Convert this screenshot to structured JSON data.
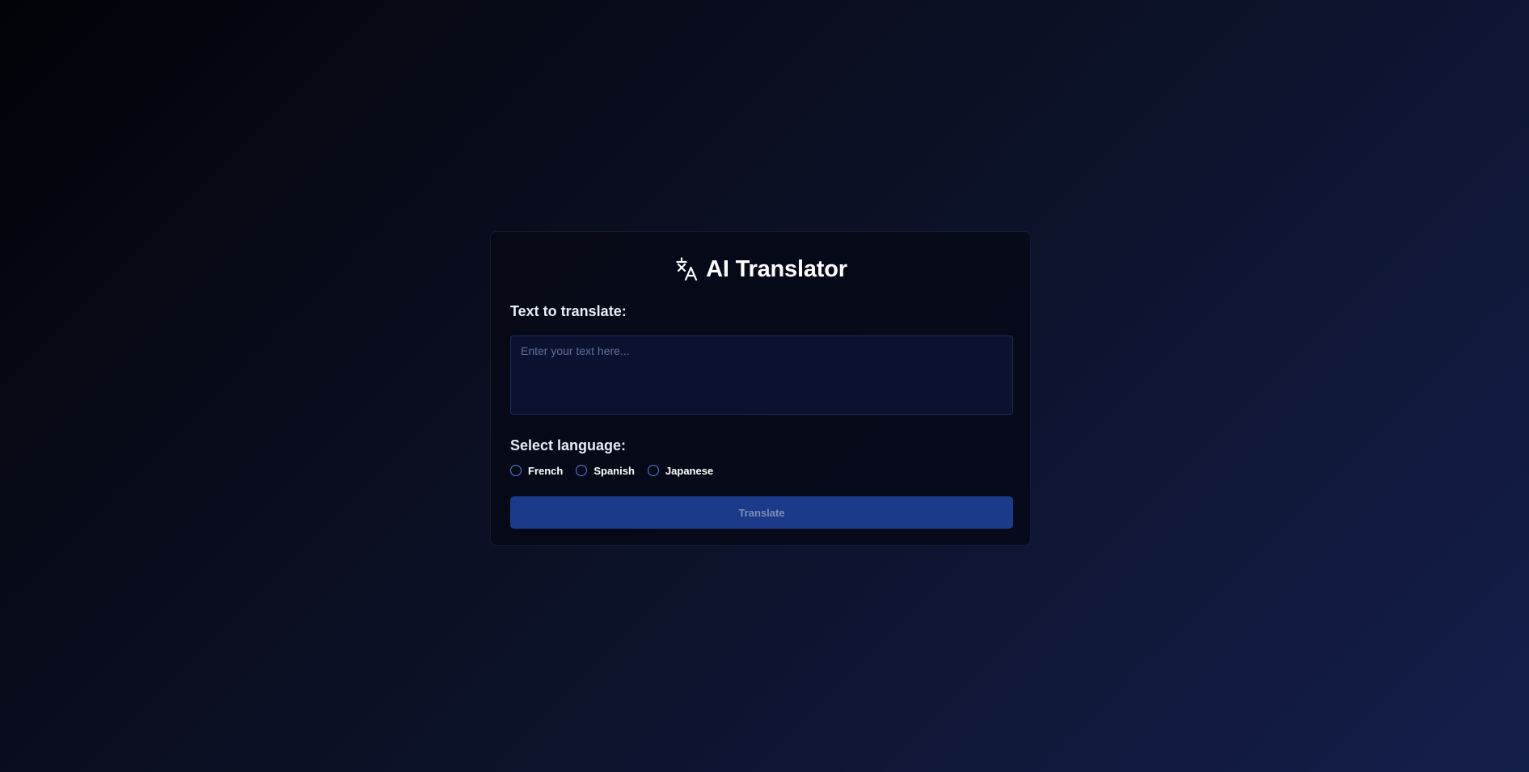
{
  "app": {
    "title": "AI Translator",
    "icon": "translate-icon"
  },
  "input": {
    "label": "Text to translate:",
    "placeholder": "Enter your text here...",
    "value": ""
  },
  "language": {
    "label": "Select language:",
    "options": [
      "French",
      "Spanish",
      "Japanese"
    ],
    "selected": null
  },
  "actions": {
    "translate_label": "Translate"
  },
  "colors": {
    "accent": "#1b3a8a",
    "radio_border": "#5c7fd6",
    "card_background": "#050814",
    "textarea_background": "#0b1230"
  }
}
